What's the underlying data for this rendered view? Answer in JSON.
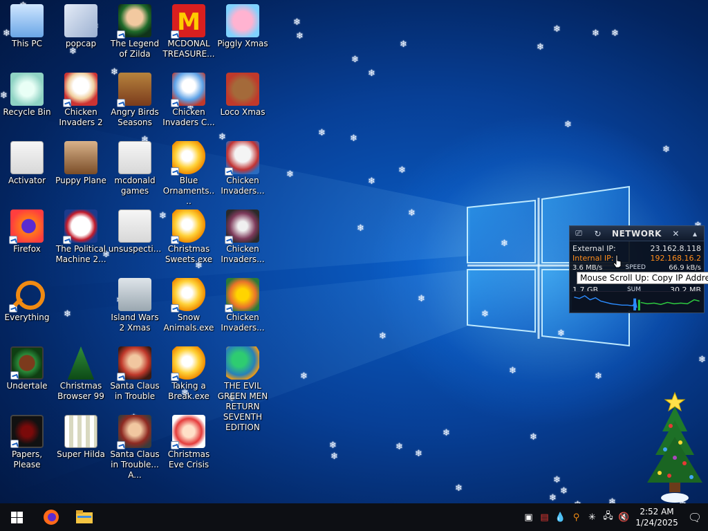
{
  "desktop": {
    "icons": [
      {
        "label": "This PC"
      },
      {
        "label": "Recycle Bin"
      },
      {
        "label": "Activator"
      },
      {
        "label": "Firefox"
      },
      {
        "label": "Everything"
      },
      {
        "label": "Undertale"
      },
      {
        "label": "Papers, Please"
      },
      {
        "label": "popcap"
      },
      {
        "label": "Chicken Invaders 2"
      },
      {
        "label": "Puppy Plane"
      },
      {
        "label": "The Political Machine 2..."
      },
      {
        "label": "Christmas Browser 99"
      },
      {
        "label": "Super Hilda"
      },
      {
        "label": "The Legend of Zilda"
      },
      {
        "label": "Angry Birds Seasons"
      },
      {
        "label": "mcdonald games"
      },
      {
        "label": "unsuspecti..."
      },
      {
        "label": "Island Wars 2 Xmas"
      },
      {
        "label": "Santa Claus in Trouble"
      },
      {
        "label": "Santa Claus in Trouble... A..."
      },
      {
        "label": "MCDONAL TREASURE..."
      },
      {
        "label": "Chicken Invaders C..."
      },
      {
        "label": "Blue Ornaments...."
      },
      {
        "label": "Christmas Sweets.exe"
      },
      {
        "label": "Snow Animals.exe"
      },
      {
        "label": "Taking a Break.exe"
      },
      {
        "label": "Christmas Eve Crisis"
      },
      {
        "label": "Piggly Xmas"
      },
      {
        "label": "Loco Xmas"
      },
      {
        "label": "Chicken Invaders..."
      },
      {
        "label": "Chicken Invaders..."
      },
      {
        "label": "Chicken Invaders..."
      },
      {
        "label": "THE EVIL GREEN MEN RETURN SEVENTH EDITION"
      }
    ],
    "pictures": {
      "popcap": "2020"
    }
  },
  "network_widget": {
    "title": "NETWORK",
    "external_ip_label": "External IP:",
    "external_ip": "23.162.8.118",
    "internal_ip_label": "Internal IP:",
    "internal_ip": "192.168.16.2",
    "speed_left": "3.6 MB/s",
    "speed_label": "SPEED",
    "speed_right": "66.9 kB/s",
    "sum_left": "1.7 GB",
    "sum_label": "SUM",
    "sum_right": "30.2 MB",
    "tooltip": "Mouse Scroll Up: Copy IP Address"
  },
  "taskbar": {
    "start": "windows-logo",
    "pinned": [
      "firefox",
      "file-explorer"
    ],
    "tray_icons": [
      "task-manager",
      "network-monitor",
      "water-drop",
      "everything-search",
      "snowflake",
      "network",
      "volume-muted"
    ],
    "time": "2:52 AM",
    "date": "1/24/2025"
  },
  "colors": {
    "accent": "#0a5ec7",
    "internal_ip": "#ff8c1a",
    "taskbar": "#0d0f14"
  }
}
